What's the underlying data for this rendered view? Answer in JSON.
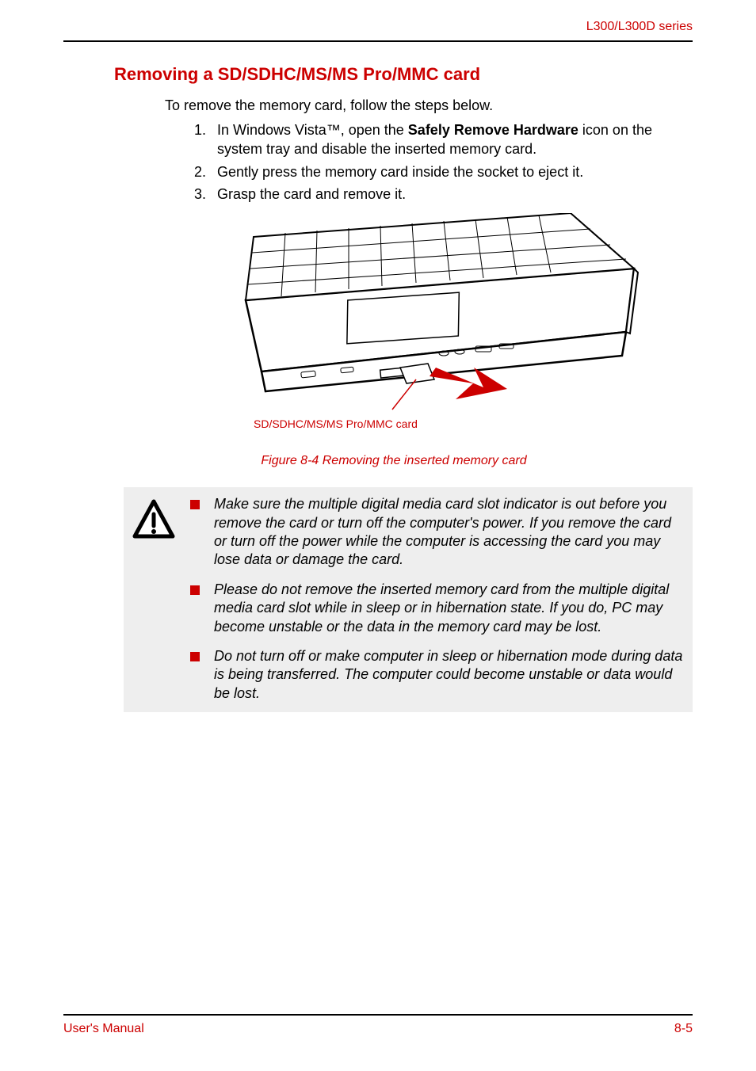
{
  "header": {
    "series_label": "L300/L300D series"
  },
  "section": {
    "title": "Removing a SD/SDHC/MS/MS Pro/MMC card",
    "intro": "To remove the memory card, follow the steps below.",
    "steps": [
      {
        "num": "1.",
        "prefix": "In Windows Vista™, open the ",
        "bold": "Safely Remove Hardware",
        "suffix": " icon on the system tray and disable the inserted memory card."
      },
      {
        "num": "2.",
        "text": "Gently press the memory card inside the socket to eject it."
      },
      {
        "num": "3.",
        "text": "Grasp the card and remove it."
      }
    ]
  },
  "figure": {
    "label": "SD/SDHC/MS/MS Pro/MMC card",
    "caption": "Figure 8-4 Removing the inserted memory card"
  },
  "caution": {
    "items": [
      "Make sure the multiple digital media card slot indicator is out before you remove the card or turn off the computer's power. If you remove the card or turn off the power while the computer is accessing the card you may lose data or damage the card.",
      "Please do not remove the inserted memory card from the multiple digital media card slot while in sleep or in hibernation state. If you do, PC may become unstable or the data in the memory card may be lost.",
      "Do not turn off or make computer in sleep or hibernation mode during data is being transferred. The computer could become unstable or data would be lost."
    ]
  },
  "footer": {
    "left": "User's Manual",
    "right": "8-5"
  }
}
